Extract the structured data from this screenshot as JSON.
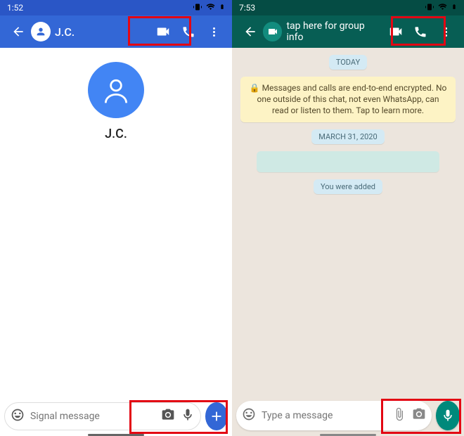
{
  "signal": {
    "clock": "1:52",
    "contactInitials": "J.C.",
    "contactFull": "J.C.",
    "composerPlaceholder": "Signal message"
  },
  "whatsapp": {
    "clock": "7:53",
    "subtitle": "tap here for group info",
    "chat": {
      "todayLabel": "TODAY",
      "encryptionNotice": "Messages and calls are end-to-end encrypted. No one outside of this chat, not even WhatsApp, can read or listen to them. Tap to learn more.",
      "dateChip": "MARCH 31, 2020",
      "addedChip": "You were added"
    },
    "composerPlaceholder": "Type a message"
  }
}
